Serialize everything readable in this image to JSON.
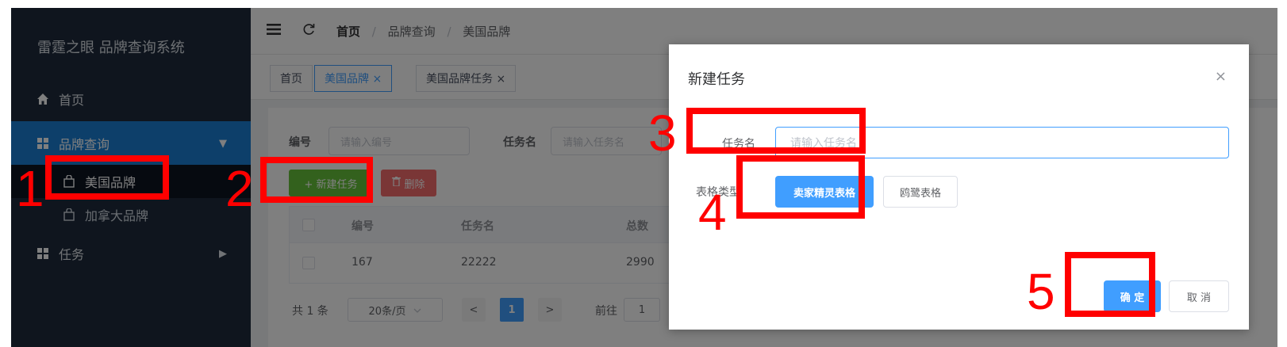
{
  "sidebar": {
    "title": "雷霆之眼 品牌查询系统",
    "items": [
      {
        "label": "首页",
        "icon": "home-icon"
      },
      {
        "label": "品牌查询",
        "icon": "grid-icon",
        "active": true,
        "arrow": "▼"
      },
      {
        "label": "任务",
        "icon": "grid-icon",
        "arrow": "▶"
      }
    ],
    "subitems": [
      {
        "label": "美国品牌",
        "icon": "bag-icon",
        "active": true
      },
      {
        "label": "加拿大品牌",
        "icon": "bag-icon"
      }
    ]
  },
  "breadcrumb": {
    "home": "首页",
    "sep": "/",
    "level2": "品牌查询",
    "level3": "美国品牌"
  },
  "tags": [
    {
      "label": "首页"
    },
    {
      "label": "美国品牌 ×",
      "active": true
    },
    {
      "label": "美国品牌任务 ×"
    }
  ],
  "filters": {
    "id_label": "编号",
    "id_placeholder": "请输入编号",
    "task_label": "任务名",
    "task_placeholder": "请输入任务名"
  },
  "actions": {
    "create": "+ 新建任务",
    "delete": "删除"
  },
  "table": {
    "columns": [
      "编号",
      "任务名",
      "总数"
    ],
    "rows": [
      {
        "id": "167",
        "name": "22222",
        "total": "2990"
      }
    ]
  },
  "pagination": {
    "total": "共 1 条",
    "page_size": "20条/页",
    "prev": "<",
    "current": "1",
    "next": ">",
    "goto_label": "前往",
    "goto_value": "1"
  },
  "dialog": {
    "title": "新建任务",
    "close": "×",
    "task_label": "任务名",
    "task_placeholder": "请输入任务名",
    "type_label": "表格类型",
    "type_options": [
      "卖家精灵表格",
      "鸥鹭表格"
    ],
    "confirm": "确 定",
    "cancel": "取 消"
  },
  "annotations": [
    "1",
    "2",
    "3",
    "4",
    "5"
  ],
  "colors": {
    "primary": "#409eff",
    "sidebar_bg": "#1e2b3c",
    "sidebar_active": "#1b7fd4",
    "success": "#67c23a",
    "danger": "#f56c6c",
    "annotation": "#ff0000"
  }
}
